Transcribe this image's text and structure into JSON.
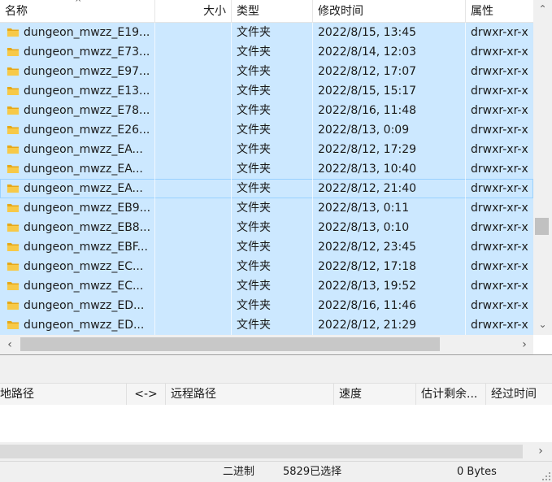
{
  "file_list": {
    "columns": {
      "name": "名称",
      "size": "大小",
      "type": "类型",
      "modified": "修改时间",
      "permissions": "属性"
    },
    "rows": [
      {
        "name": "dungeon_mwzz_E19...",
        "type": "文件夹",
        "modified": "2022/8/15, 13:45",
        "permissions": "drwxr-xr-x"
      },
      {
        "name": "dungeon_mwzz_E73...",
        "type": "文件夹",
        "modified": "2022/8/14, 12:03",
        "permissions": "drwxr-xr-x"
      },
      {
        "name": "dungeon_mwzz_E97...",
        "type": "文件夹",
        "modified": "2022/8/12, 17:07",
        "permissions": "drwxr-xr-x"
      },
      {
        "name": "dungeon_mwzz_E13...",
        "type": "文件夹",
        "modified": "2022/8/15, 15:17",
        "permissions": "drwxr-xr-x"
      },
      {
        "name": "dungeon_mwzz_E78...",
        "type": "文件夹",
        "modified": "2022/8/16, 11:48",
        "permissions": "drwxr-xr-x"
      },
      {
        "name": "dungeon_mwzz_E26...",
        "type": "文件夹",
        "modified": "2022/8/13, 0:09",
        "permissions": "drwxr-xr-x"
      },
      {
        "name": "dungeon_mwzz_EA...",
        "type": "文件夹",
        "modified": "2022/8/12, 17:29",
        "permissions": "drwxr-xr-x"
      },
      {
        "name": "dungeon_mwzz_EA...",
        "type": "文件夹",
        "modified": "2022/8/13, 10:40",
        "permissions": "drwxr-xr-x"
      },
      {
        "name": "dungeon_mwzz_EA...",
        "type": "文件夹",
        "modified": "2022/8/12, 21:40",
        "permissions": "drwxr-xr-x"
      },
      {
        "name": "dungeon_mwzz_EB9...",
        "type": "文件夹",
        "modified": "2022/8/13, 0:11",
        "permissions": "drwxr-xr-x"
      },
      {
        "name": "dungeon_mwzz_EB8...",
        "type": "文件夹",
        "modified": "2022/8/13, 0:10",
        "permissions": "drwxr-xr-x"
      },
      {
        "name": "dungeon_mwzz_EBF...",
        "type": "文件夹",
        "modified": "2022/8/12, 23:45",
        "permissions": "drwxr-xr-x"
      },
      {
        "name": "dungeon_mwzz_EC...",
        "type": "文件夹",
        "modified": "2022/8/12, 17:18",
        "permissions": "drwxr-xr-x"
      },
      {
        "name": "dungeon_mwzz_EC...",
        "type": "文件夹",
        "modified": "2022/8/13, 19:52",
        "permissions": "drwxr-xr-x"
      },
      {
        "name": "dungeon_mwzz_ED...",
        "type": "文件夹",
        "modified": "2022/8/16, 11:46",
        "permissions": "drwxr-xr-x"
      },
      {
        "name": "dungeon_mwzz_ED...",
        "type": "文件夹",
        "modified": "2022/8/12, 21:29",
        "permissions": "drwxr-xr-x"
      }
    ],
    "focused_row": 8,
    "icon": "folder-icon",
    "colors": {
      "selection": "#cce8ff",
      "folder": "#f7c948"
    }
  },
  "queue": {
    "columns": {
      "local_path": "地路径",
      "direction": "<->",
      "remote_path": "远程路径",
      "speed": "速度",
      "remaining": "估计剩余...",
      "elapsed": "经过时间"
    }
  },
  "status_bar": {
    "mode": "二进制",
    "selection": "5829已选择",
    "size": "0 Bytes"
  }
}
